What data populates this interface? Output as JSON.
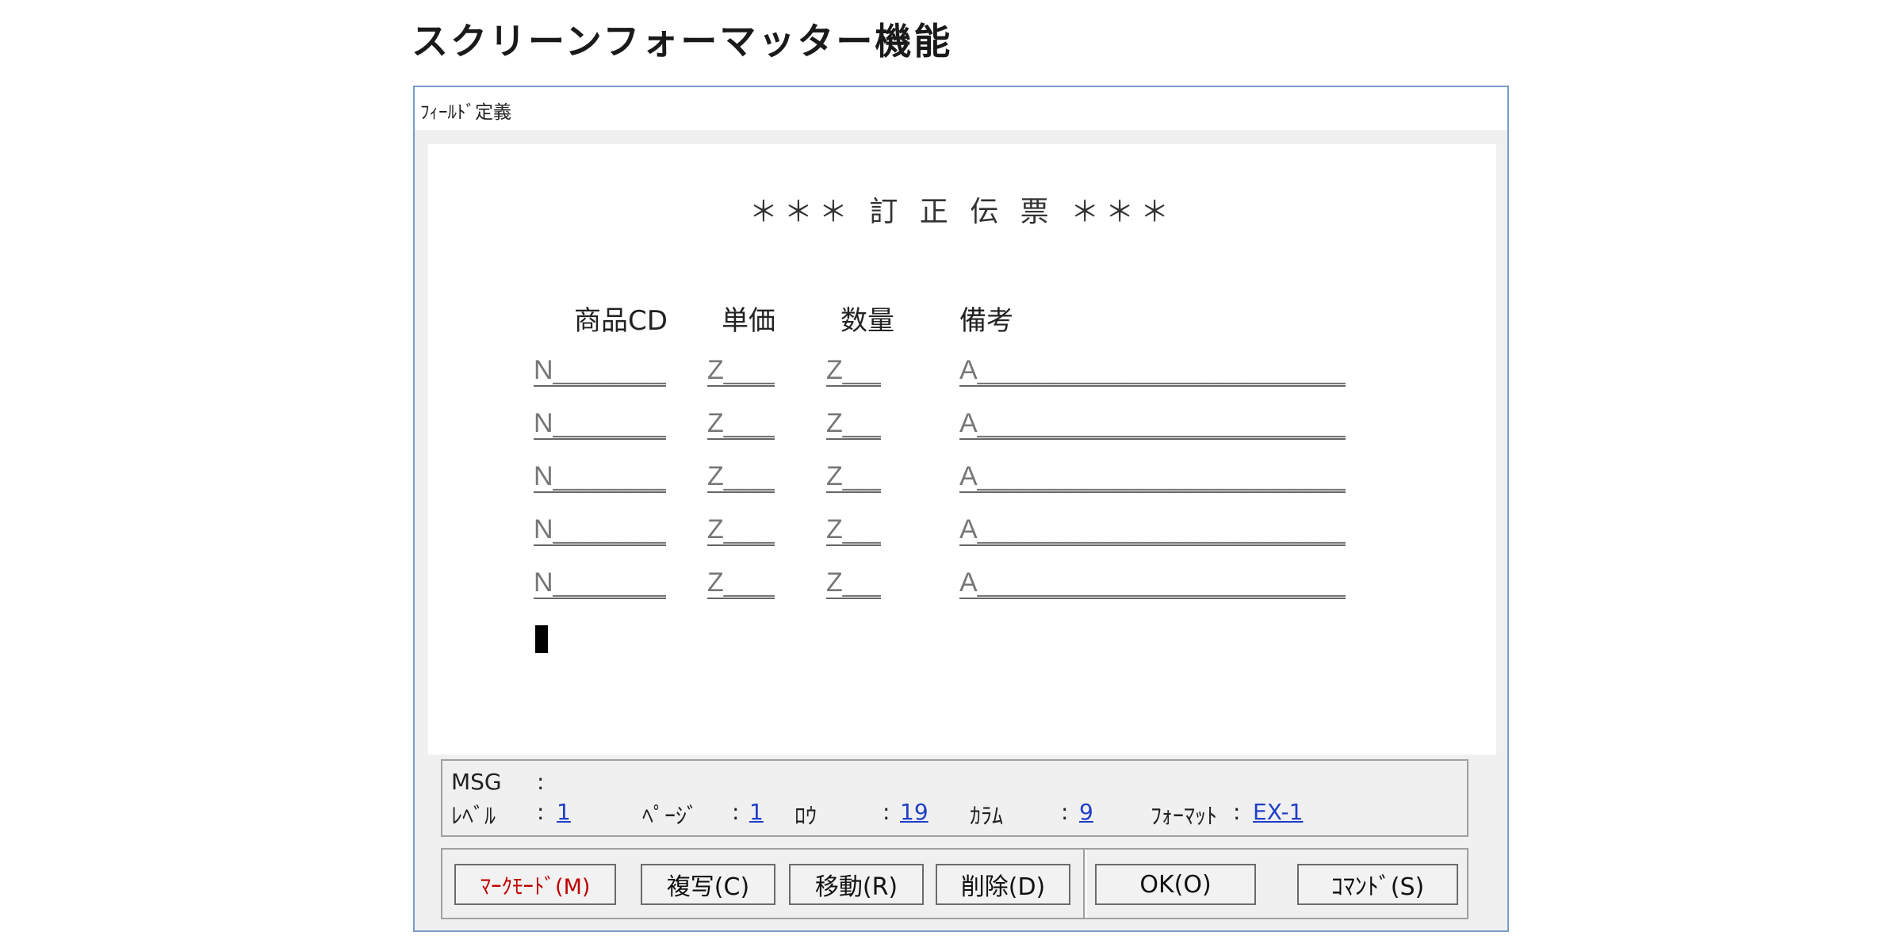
{
  "page": {
    "heading": "スクリーンフォーマッター機能"
  },
  "window": {
    "title": "ﾌｨｰﾙﾄﾞ定義"
  },
  "screen": {
    "title": "＊＊＊ 訂 正 伝 票 ＊＊＊",
    "headers": [
      "商品CD",
      "単価",
      "数量",
      "備考"
    ],
    "rows": [
      [
        "N_________",
        "Z____",
        "Z___",
        "A_____________________________"
      ],
      [
        "N_________",
        "Z____",
        "Z___",
        "A_____________________________"
      ],
      [
        "N_________",
        "Z____",
        "Z___",
        "A_____________________________"
      ],
      [
        "N_________",
        "Z____",
        "Z___",
        "A_____________________________"
      ],
      [
        "N_________",
        "Z____",
        "Z___",
        "A_____________________________"
      ]
    ]
  },
  "status": {
    "msg_label": "MSG",
    "msg_sep": ":",
    "msg_value": "",
    "level_label": "ﾚﾍﾞﾙ",
    "level_value": "1",
    "page_label": "ﾍﾟｰｼﾞ",
    "page_value": "1",
    "row_label": "ﾛｳ",
    "row_value": "19",
    "column_label": "ｶﾗﾑ",
    "column_value": "9",
    "format_label": "ﾌｫｰﾏｯﾄ",
    "format_value": "EX-1",
    "sep": ":"
  },
  "buttons": {
    "mark_mode": "ﾏｰｸﾓｰﾄﾞ(M)",
    "copy": "複写(C)",
    "move": "移動(R)",
    "delete": "削除(D)",
    "ok": "OK(O)",
    "command": "ｺﾏﾝﾄﾞ(S)"
  },
  "colors": {
    "window_border": "#7a9cc6",
    "link": "#1f3ec8",
    "mark_mode_text": "#c00000"
  }
}
